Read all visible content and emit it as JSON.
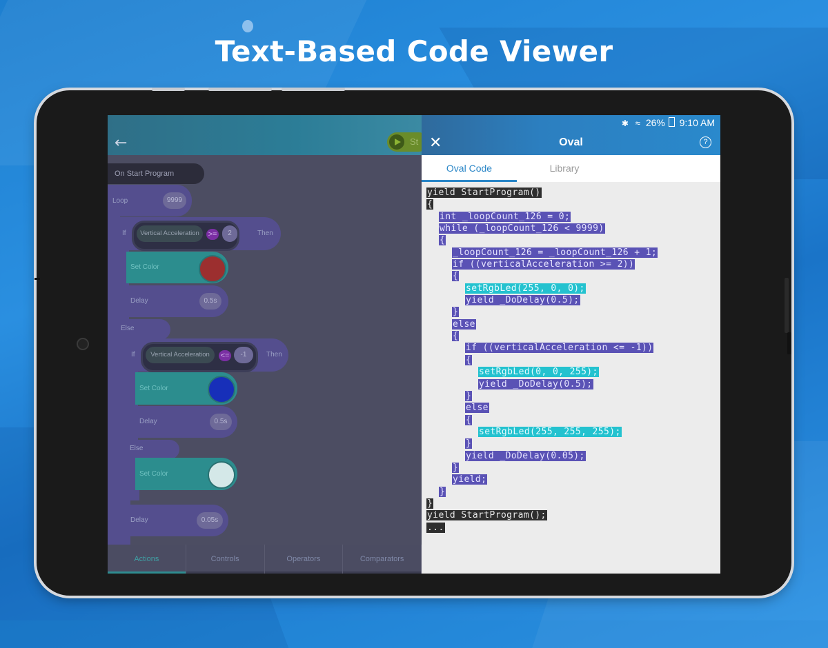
{
  "headline": "Text-Based Code Viewer",
  "status_bar": {
    "bluetooth_icon": "bluetooth-icon",
    "wifi_icon": "wifi-icon",
    "battery": "26%",
    "time": "9:10 AM"
  },
  "app_bar": {
    "title": "Oval",
    "close_icon": "close-icon",
    "help_icon": "help-icon"
  },
  "tabs": [
    {
      "label": "Oval Code",
      "active": true
    },
    {
      "label": "Library",
      "active": false
    }
  ],
  "block_editor": {
    "start_label": "St",
    "on_start": "On Start Program",
    "loop_label": "Loop",
    "loop_count": "9999",
    "if1": {
      "if_label": "If",
      "variable": "Vertical Acceleration",
      "operator": ">=",
      "value": "2",
      "then_label": "Then"
    },
    "set_color1": {
      "label": "Set Color",
      "color": "#c21010"
    },
    "delay1": {
      "label": "Delay",
      "value": "0.5s"
    },
    "else1": "Else",
    "if2": {
      "if_label": "If",
      "variable": "Vertical Acceleration",
      "operator": "<=",
      "value": "-1",
      "then_label": "Then"
    },
    "set_color2": {
      "label": "Set Color",
      "color": "#1010c8"
    },
    "delay2": {
      "label": "Delay",
      "value": "0.5s"
    },
    "else2": "Else",
    "set_color3": {
      "label": "Set Color",
      "color": "#ffffff"
    },
    "delay3": {
      "label": "Delay",
      "value": "0.05s"
    },
    "bottom_tabs": [
      "Actions",
      "Controls",
      "Operators",
      "Comparators"
    ]
  },
  "code_lines": [
    "yield StartProgram()",
    "{",
    "int _loopCount_126 = 0;",
    "while (_loopCount_126 < 9999)",
    "{",
    "_loopCount_126 = _loopCount_126 + 1;",
    "if ((verticalAcceleration >= 2))",
    "{",
    "setRgbLed(255, 0, 0);",
    "yield _DoDelay(0.5);",
    "}",
    "else",
    "{",
    "if ((verticalAcceleration <= -1))",
    "{",
    "setRgbLed(0, 0, 255);",
    "yield _DoDelay(0.5);",
    "}",
    "else",
    "{",
    "setRgbLed(255, 255, 255);",
    "}",
    "yield _DoDelay(0.05);",
    "}",
    "yield;",
    "}",
    "}",
    "yield StartProgram();",
    "..."
  ]
}
